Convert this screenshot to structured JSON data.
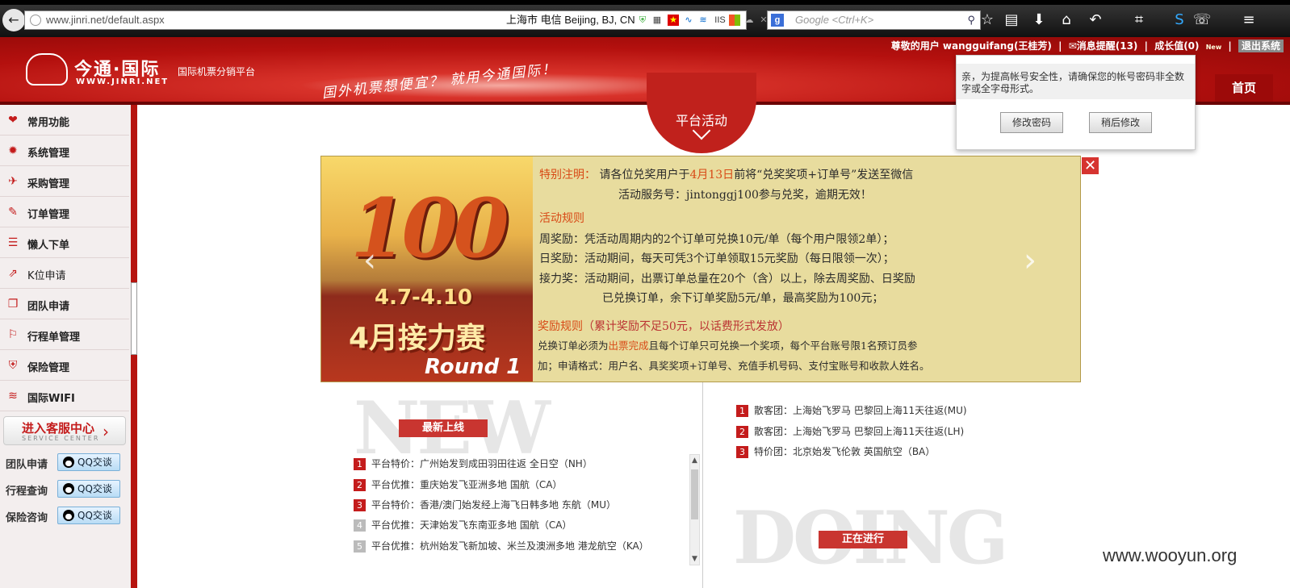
{
  "browser": {
    "url": "www.jinri.net/default.aspx",
    "location": "上海市 电信   Beijing, BJ, CN",
    "iis_label": "IIS",
    "search_placeholder": "Google <Ctrl+K>"
  },
  "header": {
    "logo_cn": "今通·国际",
    "logo_en": "WWW.JINRI.NET",
    "logo_sub": "国际机票分销平台",
    "slogan": "国外机票想便宜？ 就用今通国际！",
    "user": "尊敬的用户 wangguifang(王桂芳)",
    "messages": "✉消息提醒(13)",
    "growth": "成长值(0)",
    "new_badge": "New",
    "logout": "退出系统",
    "home": "首页"
  },
  "sidebar": {
    "items": [
      {
        "icon": "heart-icon",
        "glyph": "❤",
        "label": "常用功能"
      },
      {
        "icon": "gear-icon",
        "glyph": "✹",
        "label": "系统管理"
      },
      {
        "icon": "plane-icon",
        "glyph": "✈",
        "label": "采购管理"
      },
      {
        "icon": "edit-icon",
        "glyph": "✎",
        "label": "订单管理"
      },
      {
        "icon": "list-icon",
        "glyph": "☰",
        "label": "懒人下单"
      },
      {
        "icon": "external-icon",
        "glyph": "⇗",
        "label": "K位申请"
      },
      {
        "icon": "docs-icon",
        "glyph": "❐",
        "label": "团队申请"
      },
      {
        "icon": "signpost-icon",
        "glyph": "⚐",
        "label": "行程单管理"
      },
      {
        "icon": "briefcase-icon",
        "glyph": "⛨",
        "label": "保险管理"
      },
      {
        "icon": "wifi-icon",
        "glyph": "≋",
        "label": "国际WIFI"
      }
    ],
    "service_center": "进入客服中心",
    "service_center_en": "SERVICE CENTER",
    "qq": [
      {
        "label": "团队申请",
        "button": "QQ交谈"
      },
      {
        "label": "行程查询",
        "button": "QQ交谈"
      },
      {
        "label": "保险咨询",
        "button": "QQ交谈"
      }
    ]
  },
  "activity": {
    "tab": "平台活动",
    "banner_big": "100",
    "banner_date": "4.7-4.10",
    "banner_title": "4月接力赛",
    "banner_round": "Round 1",
    "note_label": "特别注明：",
    "note_1a": "请各位兑奖用户于",
    "note_1b": "4月13日",
    "note_1c": "前将“兑奖奖项+订单号”发送至微信",
    "note_2": "活动服务号：jintonggj100参与兑奖，逾期无效！",
    "rules_title": "活动规则",
    "rule_week_label": "周奖励：",
    "rule_week": "凭活动周期内的2个订单可兑换10元/单（每个用户限领2单）；",
    "rule_day_label": "日奖励：",
    "rule_day": "活动期间，每天可凭3个订单领取15元奖励（每日限领一次）；",
    "rule_relay_label": "接力奖：",
    "rule_relay_1": "活动期间，出票订单总量在20个（含）以上，除去周奖励、日奖励",
    "rule_relay_2": "已兑换订单，余下订单奖励5元/单，最高奖励为100元；",
    "reward_title": "奖励规则",
    "reward_note": "（累计奖励不足50元，以话费形式发放）",
    "exchange_1a": "兑换订单必须为",
    "exchange_1b": "出票完成",
    "exchange_1c": "且每个订单只可兑换一个奖项，每个平台账号限1名预订员参",
    "exchange_2": "加；申请格式：用户名、具奖奖项+订单号、充值手机号码、支付宝账号和收款人姓名。",
    "close": "✕"
  },
  "popup": {
    "message": "亲，为提高帐号安全性，请确保您的帐号密码非全数字或全字母形式。",
    "change_button": "修改密码",
    "later_button": "稍后修改"
  },
  "latest": {
    "watermark": "NEW",
    "tag": "最新上线",
    "items": [
      {
        "num": "1",
        "text": "平台特价：广州始发到成田羽田往返 全日空（NH）"
      },
      {
        "num": "2",
        "text": "平台优推：重庆始发飞亚洲多地 国航（CA）"
      },
      {
        "num": "3",
        "text": "平台特价：香港/澳门始发经上海飞日韩多地 东航（MU）"
      },
      {
        "num": "4",
        "text": "平台优推：天津始发飞东南亚多地 国航（CA）"
      },
      {
        "num": "5",
        "text": "平台优推：杭州始发飞新加坡、米兰及澳洲多地 港龙航空（KA）"
      }
    ]
  },
  "doing": {
    "watermark": "DOING",
    "tag": "正在进行",
    "items": [
      {
        "num": "1",
        "text": "散客团：上海始飞罗马 巴黎回上海11天往返(MU)"
      },
      {
        "num": "2",
        "text": "散客团：上海始飞罗马 巴黎回上海11天往返(LH)"
      },
      {
        "num": "3",
        "text": "特价团：北京始发飞伦敦 英国航空（BA）"
      }
    ]
  },
  "watermark_site": "www.wooyun.org"
}
